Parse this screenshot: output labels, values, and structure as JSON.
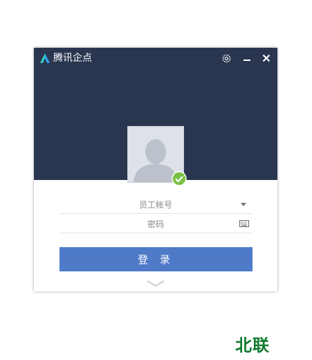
{
  "app": {
    "title": "腾讯企点"
  },
  "icons": {
    "logo": "qidian-logo-icon",
    "settings": "gear-icon",
    "minimize": "minimize-icon",
    "close": "close-icon",
    "avatar": "default-user-avatar",
    "status": "online-check-icon",
    "dropdown": "dropdown-arrow-icon",
    "keyboard": "keyboard-icon",
    "expand": "chevron-down-icon"
  },
  "form": {
    "username_placeholder": "员工帐号",
    "username_value": "",
    "password_placeholder": "密码",
    "password_value": ""
  },
  "login": {
    "label": "登 录"
  },
  "watermark": {
    "text": "北联"
  },
  "colors": {
    "header_bg": "#2a3550",
    "accent": "#4f7ac8",
    "logo_accent": "#2ed1c4",
    "status_green": "#7ac143",
    "watermark": "#0f7a2e"
  }
}
